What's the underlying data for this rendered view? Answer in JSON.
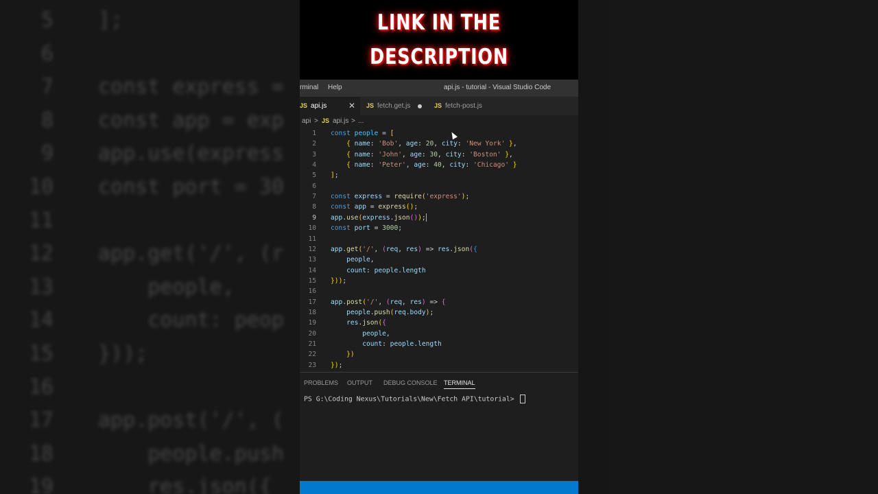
{
  "banner": {
    "line1": "LINK IN THE",
    "line2": "DESCRIPTION"
  },
  "titlebar": {
    "menu": [
      "rminal",
      "Help"
    ],
    "window_title": "api.js - tutorial - Visual Studio Code"
  },
  "tabs": [
    {
      "badge": "JS",
      "label": "api.js",
      "state": "active-close"
    },
    {
      "badge": "JS",
      "label": "fetch.get.js",
      "state": "modified"
    },
    {
      "badge": "JS",
      "label": "fetch-post.js",
      "state": "normal"
    }
  ],
  "breadcrumb": {
    "folder": "api",
    "sep": ">",
    "badge": "JS",
    "file": "api.js",
    "sep2": ">",
    "more": "..."
  },
  "editor": {
    "current_line": 9,
    "lines": [
      {
        "n": "1",
        "t": "const people = ["
      },
      {
        "n": "2",
        "t": "    { name: 'Bob', age: 20, city: 'New York' },"
      },
      {
        "n": "3",
        "t": "    { name: 'John', age: 30, city: 'Boston' },"
      },
      {
        "n": "4",
        "t": "    { name: 'Peter', age: 40, city: 'Chicago' }"
      },
      {
        "n": "5",
        "t": "];"
      },
      {
        "n": "6",
        "t": ""
      },
      {
        "n": "7",
        "t": "const express = require('express');"
      },
      {
        "n": "8",
        "t": "const app = express();"
      },
      {
        "n": "9",
        "t": "app.use(express.json());"
      },
      {
        "n": "10",
        "t": "const port = 3000;"
      },
      {
        "n": "11",
        "t": ""
      },
      {
        "n": "12",
        "t": "app.get('/', (req, res) => res.json({"
      },
      {
        "n": "13",
        "t": "    people,"
      },
      {
        "n": "14",
        "t": "    count: people.length"
      },
      {
        "n": "15",
        "t": "}));"
      },
      {
        "n": "16",
        "t": ""
      },
      {
        "n": "17",
        "t": "app.post('/', (req, res) => {"
      },
      {
        "n": "18",
        "t": "    people.push(req.body);"
      },
      {
        "n": "19",
        "t": "    res.json({"
      },
      {
        "n": "20",
        "t": "        people,"
      },
      {
        "n": "21",
        "t": "        count: people.length"
      },
      {
        "n": "22",
        "t": "    })"
      },
      {
        "n": "23",
        "t": "});"
      }
    ]
  },
  "background_code": [
    {
      "n": "5",
      "t": "];"
    },
    {
      "n": "6",
      "t": ""
    },
    {
      "n": "7",
      "t": "const express = "
    },
    {
      "n": "8",
      "t": "const app = exp"
    },
    {
      "n": "9",
      "t": "app.use(express"
    },
    {
      "n": "10",
      "t": "const port = 30"
    },
    {
      "n": "11",
      "t": ""
    },
    {
      "n": "12",
      "t": "app.get('/', (r"
    },
    {
      "n": "13",
      "t": "    people,"
    },
    {
      "n": "14",
      "t": "    count: peop"
    },
    {
      "n": "15",
      "t": "}));"
    },
    {
      "n": "16",
      "t": ""
    },
    {
      "n": "17",
      "t": "app.post('/', ("
    },
    {
      "n": "18",
      "t": "    people.push"
    },
    {
      "n": "19",
      "t": "    res.json({"
    }
  ],
  "panel": {
    "tabs": [
      "PROBLEMS",
      "OUTPUT",
      "DEBUG CONSOLE",
      "TERMINAL"
    ],
    "active_tab": "TERMINAL",
    "prompt": "PS G:\\Coding Nexus\\Tutorials\\New\\Fetch API\\tutorial> "
  },
  "colors": {
    "accent": "#007acc",
    "banner_glow": "#ff2a2a"
  },
  "icons": {
    "tab_close": "close-icon",
    "modified": "modified-dot-icon",
    "mouse": "mouse-pointer-icon"
  }
}
